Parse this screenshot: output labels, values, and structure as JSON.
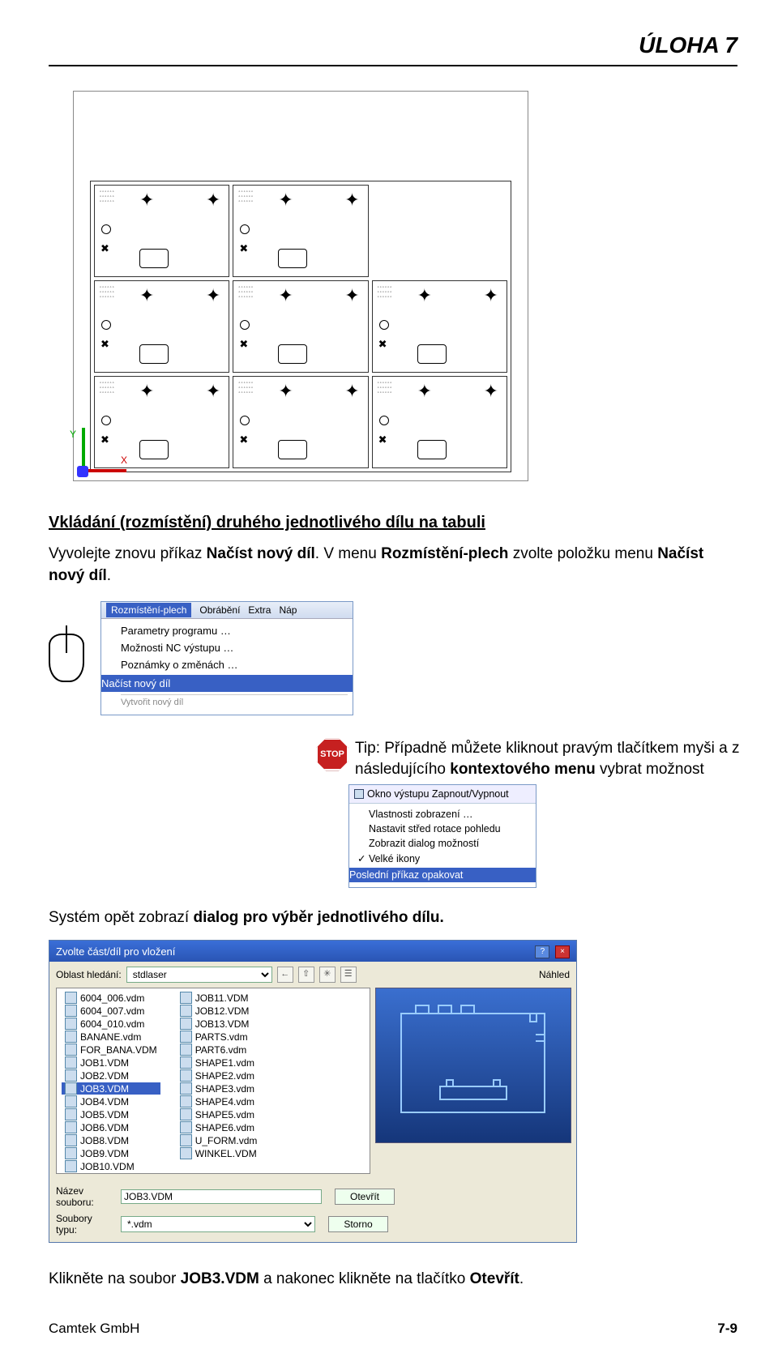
{
  "header": {
    "title": "ÚLOHA 7"
  },
  "axis": {
    "x": "X",
    "y": "Y"
  },
  "section": {
    "heading": "Vkládání (rozmístění) druhého jednotlivého dílu na tabuli",
    "line1a": "Vyvolejte znovu příkaz ",
    "line1b": "Načíst nový díl",
    "line1c": ". V menu ",
    "line1d": "Rozmístění-plech",
    "line1e": " zvolte položku menu ",
    "line1f": "Načíst nový díl",
    "line1g": "."
  },
  "menu1": {
    "tabs": {
      "sel": "Rozmístění-plech",
      "t2": "Obrábění",
      "t3": "Extra",
      "t4": "Náp"
    },
    "items": {
      "i1": "Parametry programu …",
      "i2": "Možnosti NC výstupu …",
      "i3": "Poznámky o změnách …",
      "hl": "Načíst nový díl",
      "cut": "Vytvořit nový díl"
    }
  },
  "tip": {
    "stop": "STOP",
    "text1": "Tip: Případně můžete kliknout pravým tlačítkem myši a z následujícího ",
    "bold": "kontextového menu",
    "text2": " vybrat  možnost"
  },
  "ctx": {
    "head": "Okno výstupu Zapnout/Vypnout",
    "i1": "Vlastnosti zobrazení …",
    "i2": "Nastavit střed rotace pohledu",
    "i3": "Zobrazit dialog možností",
    "i4": "Velké ikony",
    "hl": "Poslední příkaz opakovat"
  },
  "para2a": "Systém opět zobrazí ",
  "para2b": "dialog pro výběr jednotlivého dílu.",
  "dialog": {
    "title": "Zvolte část/díl pro vložení",
    "look_label": "Oblast hledání:",
    "look_value": "stdlaser",
    "preview_label": "Náhled",
    "files_col1": [
      "6004_006.vdm",
      "6004_007.vdm",
      "6004_010.vdm",
      "BANANE.vdm",
      "FOR_BANA.VDM",
      "JOB1.VDM",
      "JOB2.VDM",
      "JOB3.VDM",
      "JOB4.VDM",
      "JOB5.VDM",
      "JOB6.VDM",
      "JOB8.VDM",
      "JOB9.VDM",
      "JOB10.VDM"
    ],
    "files_col2": [
      "JOB11.VDM",
      "JOB12.VDM",
      "JOB13.VDM",
      "PARTS.vdm",
      "PART6.vdm",
      "SHAPE1.vdm",
      "SHAPE2.vdm",
      "SHAPE3.vdm",
      "SHAPE4.vdm",
      "SHAPE5.vdm",
      "SHAPE6.vdm",
      "U_FORM.vdm",
      "WINKEL.VDM"
    ],
    "selected": "JOB3.VDM",
    "name_label": "Název souboru:",
    "name_value": "JOB3.VDM",
    "type_label": "Soubory typu:",
    "type_value": "*.vdm",
    "open": "Otevřít",
    "cancel": "Storno"
  },
  "bottom": {
    "t1": "Klikněte na soubor ",
    "b1": "JOB3.VDM",
    "t2": "  a nakonec klikněte na tlačítko ",
    "b2": "Otevřít",
    "t3": "."
  },
  "footer": {
    "left": "Camtek GmbH",
    "right": "7-9"
  }
}
